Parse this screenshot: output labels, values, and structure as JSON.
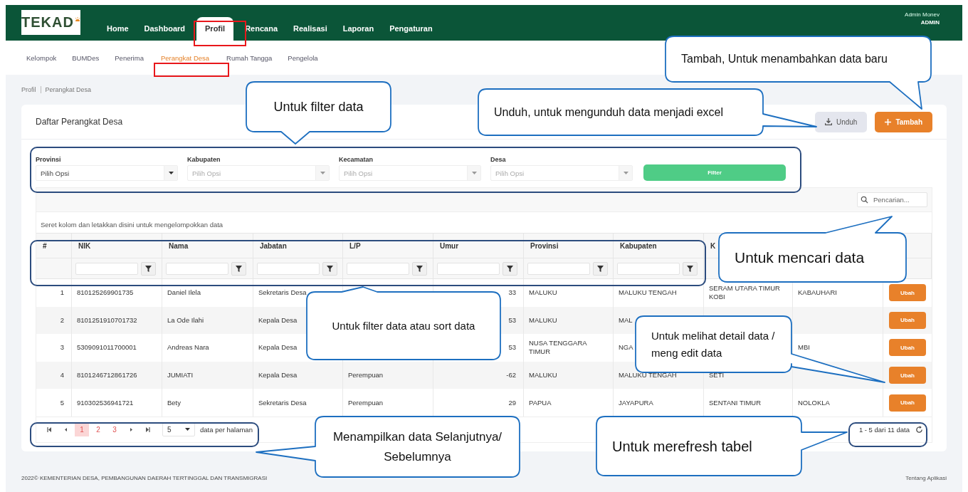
{
  "header": {
    "logo_text": "TEKAD",
    "nav": [
      {
        "label": "Home",
        "selected": false
      },
      {
        "label": "Dashboard",
        "selected": false
      },
      {
        "label": "Profil",
        "selected": true
      },
      {
        "label": "Rencana",
        "selected": false
      },
      {
        "label": "Realisasi",
        "selected": false
      },
      {
        "label": "Laporan",
        "selected": false
      },
      {
        "label": "Pengaturan",
        "selected": false
      }
    ],
    "user": {
      "name": "Admin Monev",
      "role": "ADMIN"
    }
  },
  "subnav": [
    {
      "label": "Kelompok",
      "selected": false
    },
    {
      "label": "BUMDes",
      "selected": false
    },
    {
      "label": "Penerima",
      "selected": false
    },
    {
      "label": "Perangkat Desa",
      "selected": true
    },
    {
      "label": "Rumah Tangga",
      "selected": false
    },
    {
      "label": "Pengelola",
      "selected": false
    }
  ],
  "breadcrumb": [
    "Profil",
    "Perangkat Desa"
  ],
  "card": {
    "title": "Daftar Perangkat Desa",
    "buttons": [
      {
        "label": "Unduh",
        "kind": "download"
      },
      {
        "label": "Tambah",
        "kind": "add"
      }
    ]
  },
  "filters": [
    {
      "label": "Provinsi",
      "placeholder": "Pilih Opsi",
      "disabled": false
    },
    {
      "label": "Kabupaten",
      "placeholder": "Pilih Opsi",
      "disabled": true
    },
    {
      "label": "Kecamatan",
      "placeholder": "Pilih Opsi",
      "disabled": true
    },
    {
      "label": "Desa",
      "placeholder": "Pilih Opsi",
      "disabled": true
    }
  ],
  "filter_button": "Filter",
  "search": {
    "placeholder": "Pencarian..."
  },
  "group_panel": "Seret kolom dan letakkan disini untuk mengelompokkan data",
  "table": {
    "columns": [
      {
        "label": "#",
        "filter": false
      },
      {
        "label": "NIK",
        "filter": true
      },
      {
        "label": "Nama",
        "filter": true
      },
      {
        "label": "Jabatan",
        "filter": true
      },
      {
        "label": "L/P",
        "filter": true
      },
      {
        "label": "Umur",
        "filter": true
      },
      {
        "label": "Provinsi",
        "filter": true
      },
      {
        "label": "Kabupaten",
        "filter": true
      },
      {
        "label": "K",
        "filter": false
      }
    ],
    "rows": [
      {
        "cells": [
          "1",
          "810125269901735",
          "Daniel Ilela",
          "Sekretaris Desa",
          null,
          "33",
          "MALUKU",
          "MALUKU TENGAH",
          "SERAM UTARA TIMUR KOBI",
          "KABAUHARI"
        ],
        "action": "Ubah"
      },
      {
        "cells": [
          "2",
          "8101251910701732",
          "La Ode Ilahi",
          "Kepala Desa",
          null,
          "53",
          "MALUKU",
          "MAL",
          null,
          null
        ],
        "action": "Ubah"
      },
      {
        "cells": [
          "3",
          "5309091011700001",
          "Andreas Nara",
          "Kepala Desa",
          null,
          "53",
          "NUSA TENGGARA TIMUR",
          "NGA",
          null,
          "MBI"
        ],
        "action": "Ubah"
      },
      {
        "cells": [
          "4",
          "8101246712861726",
          "JUMIATI",
          "Kepala Desa",
          "Perempuan",
          "-62",
          "MALUKU",
          "MALUKU TENGAH",
          "SETI",
          null
        ],
        "action": "Ubah"
      },
      {
        "cells": [
          "5",
          "910302536941721",
          "Bety",
          "Sekretaris Desa",
          "Perempuan",
          "29",
          "PAPUA",
          "JAYAPURA",
          "SENTANI TIMUR",
          "NOLOKLA"
        ],
        "action": "Ubah"
      }
    ]
  },
  "pager": {
    "pages": [
      {
        "label": "1",
        "selected": true
      },
      {
        "label": "2",
        "selected": false
      },
      {
        "label": "3",
        "selected": false
      }
    ],
    "page_size": "5",
    "page_size_label": "data per halaman",
    "info": "1 - 5 dari 11 data"
  },
  "footer": {
    "copyright": "2022© KEMENTERIAN DESA, PEMBANGUNAN DAERAH TERTINGGAL DAN TRANSMIGRASI",
    "link": "Tentang Aplikasi"
  },
  "callouts": [
    {
      "text": "Untuk filter data"
    },
    {
      "text": "Tambah, Untuk menambahkan data baru"
    },
    {
      "text": "Unduh, untuk mengunduh data menjadi excel"
    },
    {
      "text": "Untuk mencari data"
    },
    {
      "text": "Untuk filter data atau sort data"
    },
    {
      "text": "Untuk melihat detail data / meng edit data"
    },
    {
      "text": "Menampilkan data Selanjutnya/ Sebelumnya"
    },
    {
      "text": "Untuk merefresh tabel"
    }
  ]
}
